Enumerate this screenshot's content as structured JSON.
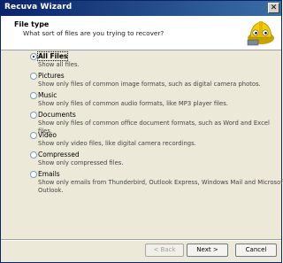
{
  "window": {
    "title": "Recuva Wizard",
    "close_glyph": "✕"
  },
  "header": {
    "title": "File type",
    "subtitle": "What sort of files are you trying to recover?"
  },
  "options": [
    {
      "label": "All Files",
      "description": "Show all files.",
      "selected": true
    },
    {
      "label": "Pictures",
      "description": "Show only files of common image formats, such as digital camera photos.",
      "selected": false
    },
    {
      "label": "Music",
      "description": "Show only files of common audio formats, like MP3 player files.",
      "selected": false
    },
    {
      "label": "Documents",
      "description": "Show only files of common office document formats, such as Word and Excel files.",
      "selected": false
    },
    {
      "label": "Video",
      "description": "Show only video files, like digital camera recordings.",
      "selected": false
    },
    {
      "label": "Compressed",
      "description": "Show only compressed files.",
      "selected": false
    },
    {
      "label": "Emails",
      "description": "Show only emails from Thunderbird, Outlook Express, Windows Mail and Microsoft Outlook.",
      "selected": false
    }
  ],
  "buttons": {
    "back": "< Back",
    "next": "Next >",
    "cancel": "Cancel"
  },
  "icons": {
    "logo": "recuva-hardhat-logo-icon"
  }
}
